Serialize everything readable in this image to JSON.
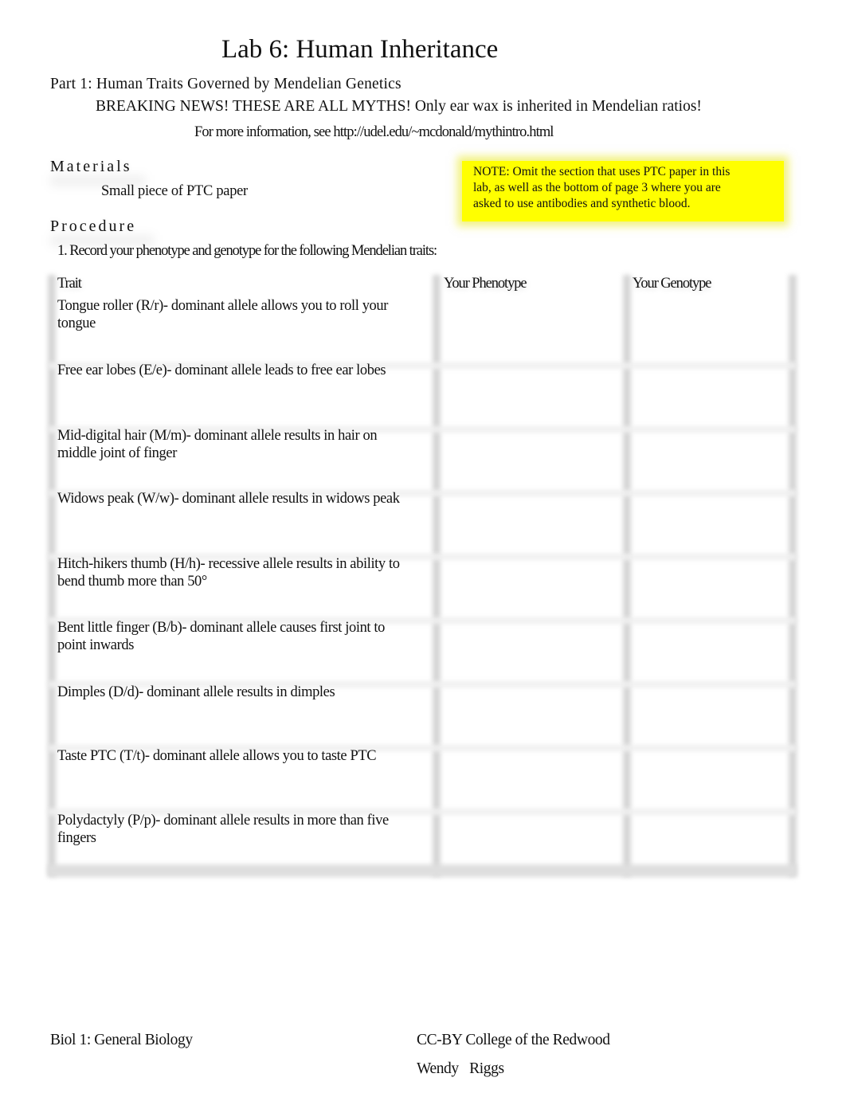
{
  "document": {
    "title": "Lab 6: Human Inheritance",
    "part_heading": "Part 1: Human Traits Governed by Mendelian Genetics",
    "breaking_news": "BREAKING NEWS! THESE ARE ALL MYTHS! Only ear wax is inherited in Mendelian ratios!",
    "more_info": "For more information, see http://udel.edu/~mcdonald/mythintro.html",
    "note": {
      "line1": "NOTE: Omit the section that uses PTC paper in this",
      "line2": "lab, as well as the bottom of page 3 where you are",
      "line3": "asked to use antibodies and synthetic blood.",
      "color": "#ffff00"
    },
    "materials": {
      "heading": "Materials",
      "items": [
        "Small piece of PTC paper"
      ]
    },
    "procedure": {
      "heading": "Procedure",
      "step1": "1. Record your phenotype and genotype for the following Mendelian traits:"
    },
    "table": {
      "headers": [
        "Trait",
        "Your Phenotype",
        "Your Genotype"
      ],
      "rows": [
        {
          "trait": "Tongue roller (R/r)- dominant allele allows you to roll your tongue",
          "phenotype": "",
          "genotype": ""
        },
        {
          "trait": "Free ear lobes (E/e)- dominant allele leads to free ear lobes",
          "phenotype": "",
          "genotype": ""
        },
        {
          "trait": "Mid-digital hair (M/m)- dominant allele results in hair on middle joint of finger",
          "phenotype": "",
          "genotype": ""
        },
        {
          "trait": "Widows peak (W/w)- dominant allele results in widows peak",
          "phenotype": "",
          "genotype": ""
        },
        {
          "trait": "Hitch-hikers thumb (H/h)- recessive allele results in ability to bend thumb more than 50°",
          "phenotype": "",
          "genotype": ""
        },
        {
          "trait": "Bent little finger (B/b)- dominant allele causes first joint to point inwards",
          "phenotype": "",
          "genotype": ""
        },
        {
          "trait": "Dimples (D/d)- dominant allele results in dimples",
          "phenotype": "",
          "genotype": ""
        },
        {
          "trait": "Taste PTC (T/t)- dominant allele allows you to taste PTC",
          "phenotype": "",
          "genotype": ""
        },
        {
          "trait": "Polydactyly (P/p)- dominant allele results in more than five fingers",
          "phenotype": "",
          "genotype": ""
        }
      ]
    },
    "footer": {
      "course": "Biol 1: General Biology",
      "license": "CC-BY College of the Redwood",
      "author": "Wendy   Riggs"
    }
  }
}
